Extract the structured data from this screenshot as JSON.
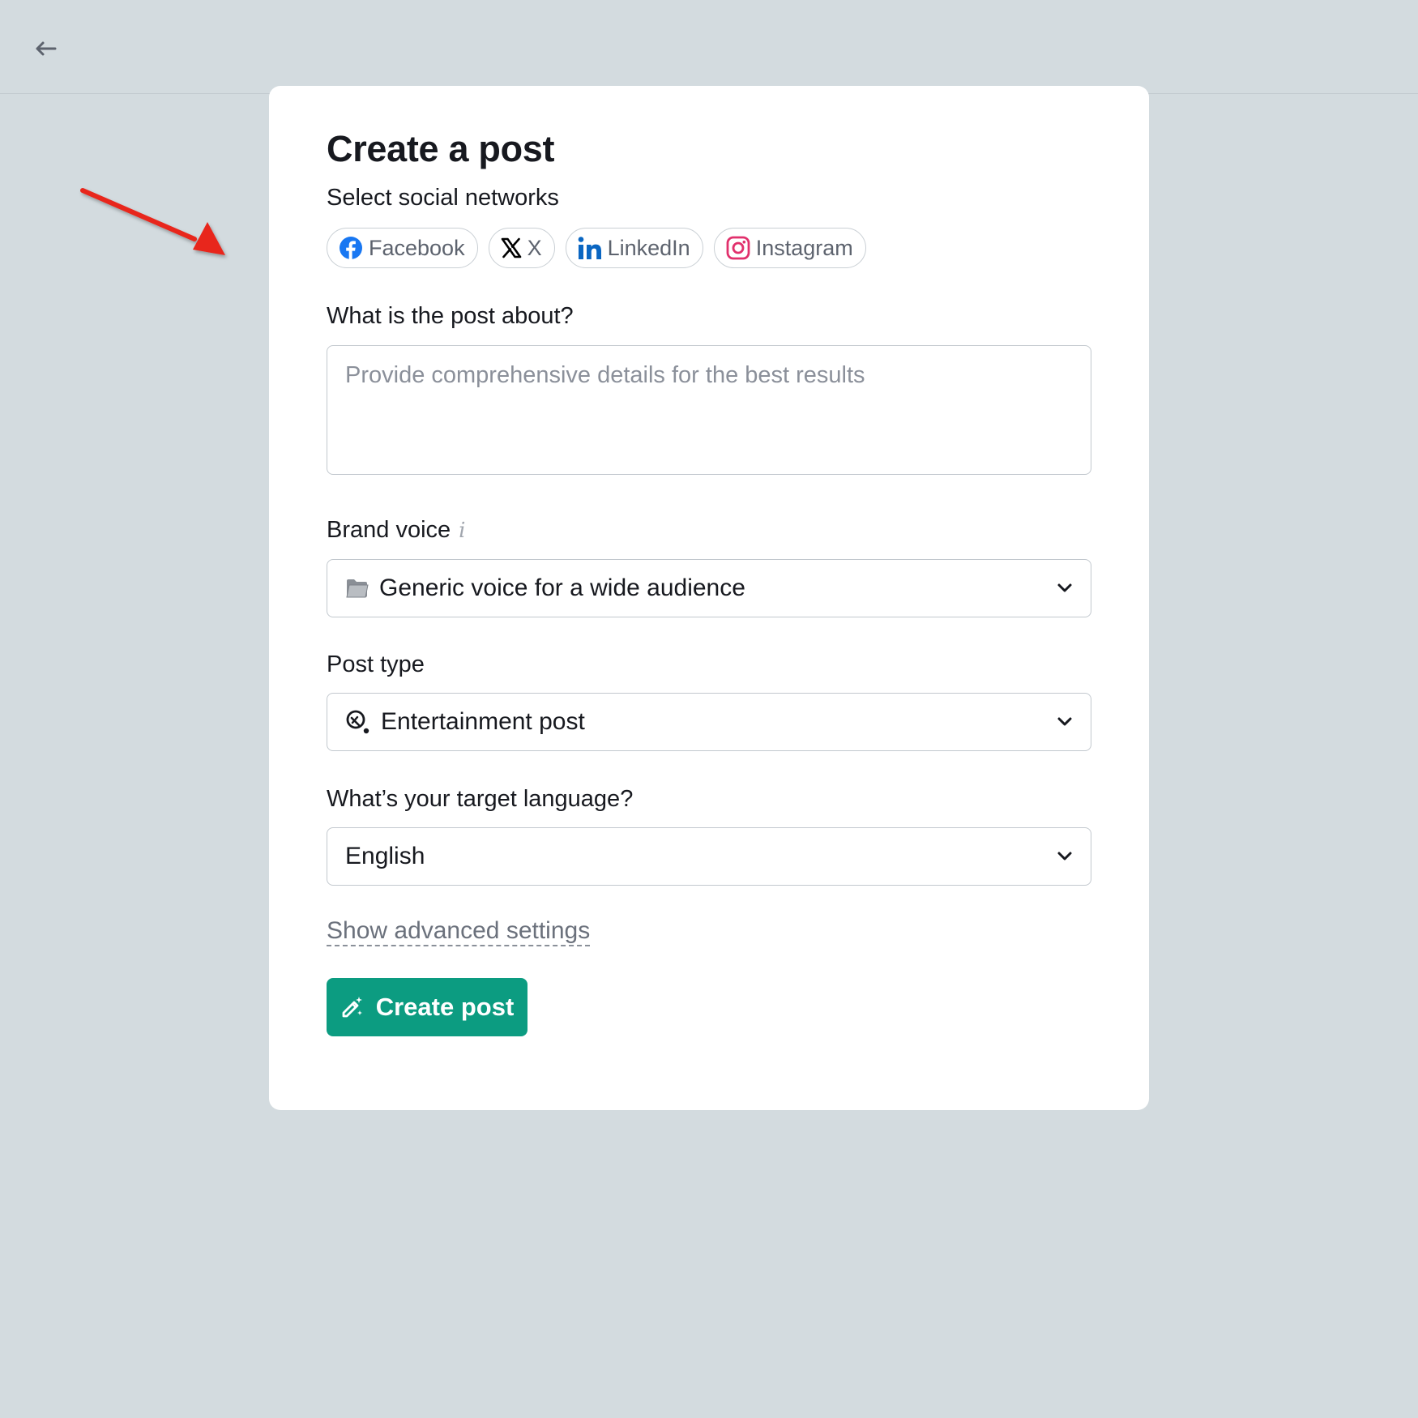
{
  "topbar": {
    "back_icon": "arrow-left-icon"
  },
  "annotation": {
    "icon": "red-arrow-icon",
    "color": "#e8251a"
  },
  "form": {
    "title": "Create a post",
    "networks_label": "Select social networks",
    "networks": [
      {
        "label": "Facebook",
        "icon": "facebook-icon",
        "color": "#1877f2"
      },
      {
        "label": "X",
        "icon": "x-logo-icon",
        "color": "#000000"
      },
      {
        "label": "LinkedIn",
        "icon": "linkedin-icon",
        "color": "#0a66c2"
      },
      {
        "label": "Instagram",
        "icon": "instagram-icon",
        "color": "#e1306c"
      }
    ],
    "about_label": "What is the post about?",
    "about_placeholder": "Provide comprehensive details for the best results",
    "about_value": "",
    "brand_voice_label": "Brand voice",
    "brand_voice_info": "i",
    "brand_voice_value": "Generic voice for a wide audience",
    "brand_voice_icon": "folder-icon",
    "post_type_label": "Post type",
    "post_type_value": "Entertainment post",
    "post_type_icon": "entertainment-icon",
    "language_label": "What’s your target language?",
    "language_value": "English",
    "advanced_link": "Show advanced settings",
    "submit_label": "Create post",
    "submit_icon": "magic-pen-icon",
    "accent_color": "#0c9c81"
  }
}
